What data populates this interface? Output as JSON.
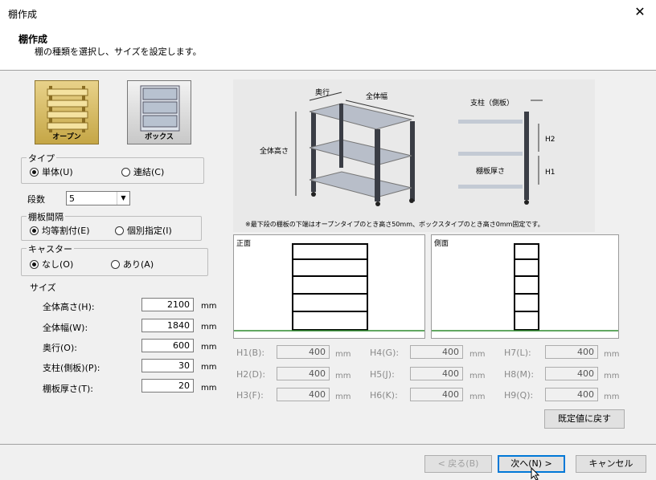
{
  "window": {
    "title": "棚作成",
    "close_glyph": "✕"
  },
  "header": {
    "title": "棚作成",
    "subtitle": "棚の種類を選択し、サイズを設定します。"
  },
  "types": [
    {
      "label": "オープン",
      "icon": "open-shelf-icon",
      "selected": true
    },
    {
      "label": "ボックス",
      "icon": "box-shelf-icon",
      "selected": false
    }
  ],
  "type_group": {
    "legend": "タイプ",
    "options": [
      "単体(U)",
      "連結(C)"
    ],
    "selected": 0
  },
  "shelf_count": {
    "label": "段数",
    "value": "5"
  },
  "spacing_group": {
    "legend": "棚板間隔",
    "options": [
      "均等割付(E)",
      "個別指定(I)"
    ],
    "selected": 0
  },
  "caster_group": {
    "legend": "キャスター",
    "options": [
      "なし(O)",
      "あり(A)"
    ],
    "selected": 0
  },
  "size": {
    "label": "サイズ",
    "fields": [
      {
        "label": "全体高さ(H):",
        "value": "2100",
        "unit": "mm"
      },
      {
        "label": "全体幅(W):",
        "value": "1840",
        "unit": "mm"
      },
      {
        "label": "奥行(O):",
        "value": "600",
        "unit": "mm"
      },
      {
        "label": "支柱(側板)(P):",
        "value": "30",
        "unit": "mm"
      },
      {
        "label": "棚板厚さ(T):",
        "value": "20",
        "unit": "mm"
      }
    ]
  },
  "diagram": {
    "labels": {
      "depth": "奥行",
      "width": "全体幅",
      "height": "全体高さ",
      "post": "支柱（側板）",
      "h2": "H2",
      "h1": "H1",
      "thickness": "棚板厚さ"
    },
    "note": "※最下段の棚板の下端はオープンタイプのとき高さ50mm、ボックスタイプのとき高さ0mm固定です。"
  },
  "views": {
    "front": "正面",
    "side": "側面"
  },
  "heights": [
    {
      "label": "H1(B):",
      "value": "400",
      "unit": "mm"
    },
    {
      "label": "H4(G):",
      "value": "400",
      "unit": "mm"
    },
    {
      "label": "H7(L):",
      "value": "400",
      "unit": "mm"
    },
    {
      "label": "H2(D):",
      "value": "400",
      "unit": "mm"
    },
    {
      "label": "H5(J):",
      "value": "400",
      "unit": "mm"
    },
    {
      "label": "H8(M):",
      "value": "400",
      "unit": "mm"
    },
    {
      "label": "H3(F):",
      "value": "400",
      "unit": "mm"
    },
    {
      "label": "H6(K):",
      "value": "400",
      "unit": "mm"
    },
    {
      "label": "H9(Q):",
      "value": "400",
      "unit": "mm"
    }
  ],
  "buttons": {
    "reset": "既定値に戻す",
    "back": "< 戻る(B)",
    "next": "次へ(N) >",
    "cancel": "キャンセル"
  },
  "colors": {
    "selected_type_bg": "#d9bf6a",
    "ground_line": "#2e8b2e",
    "focus_border": "#0078d7"
  }
}
